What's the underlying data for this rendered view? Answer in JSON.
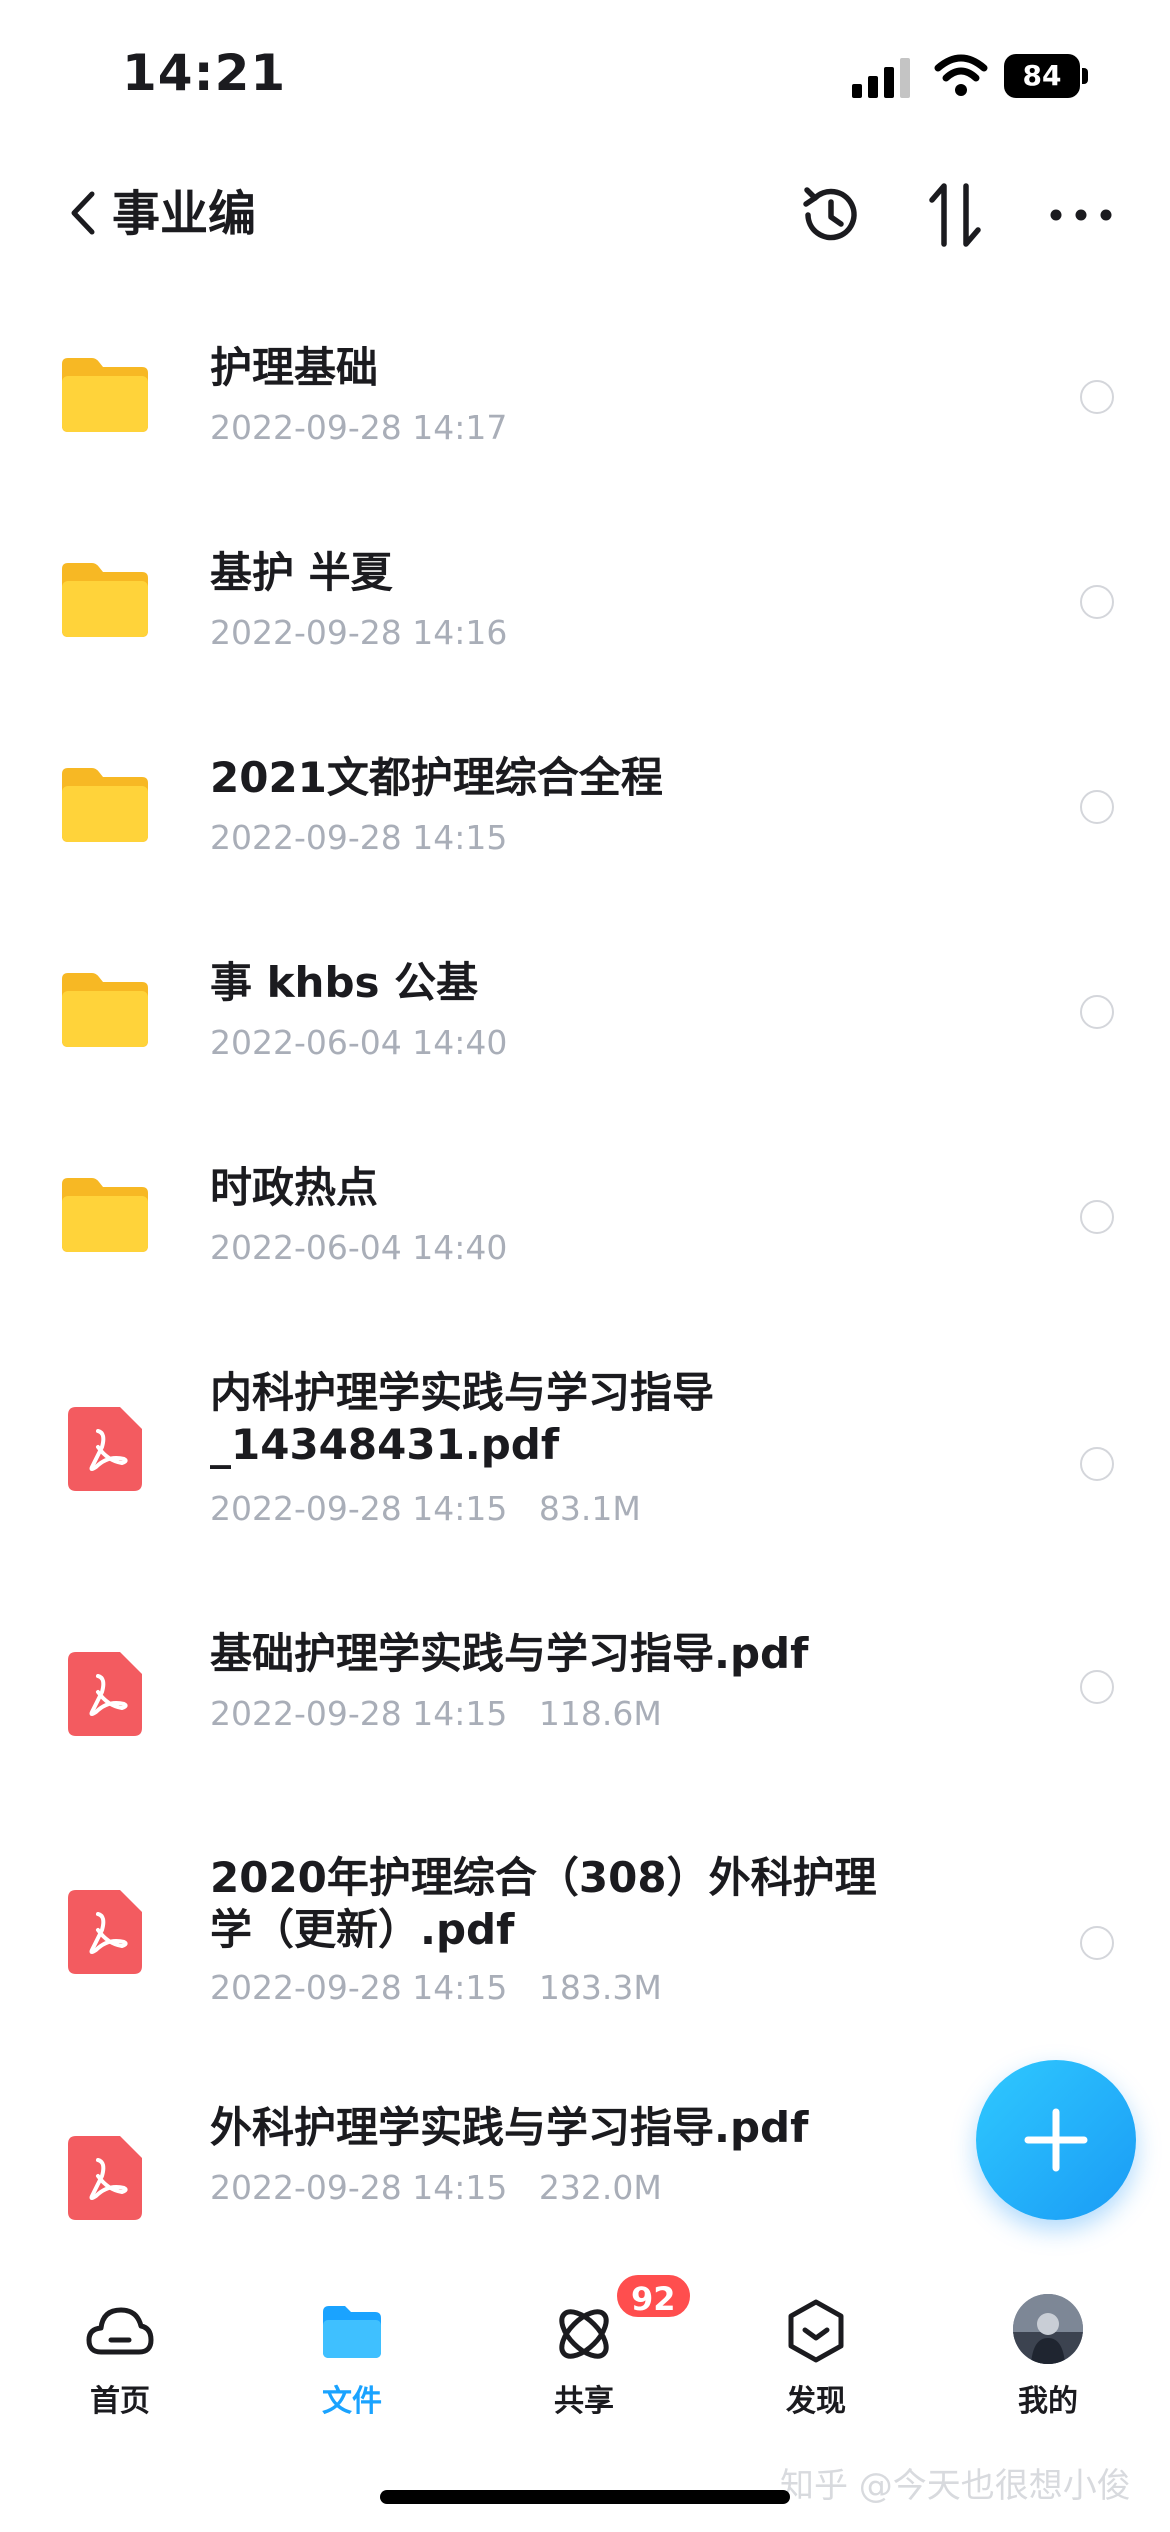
{
  "status": {
    "time": "14:21",
    "battery": "84"
  },
  "header": {
    "title": "事业编"
  },
  "files": [
    {
      "type": "folder",
      "name": "护理基础",
      "date": "2022-09-28 14:17",
      "size": ""
    },
    {
      "type": "folder",
      "name": "基护 半夏",
      "date": "2022-09-28 14:16",
      "size": ""
    },
    {
      "type": "folder",
      "name": "2021文都护理综合全程",
      "date": "2022-09-28 14:15",
      "size": ""
    },
    {
      "type": "folder",
      "name": "事 khbs 公基",
      "date": "2022-06-04 14:40",
      "size": ""
    },
    {
      "type": "folder",
      "name": "时政热点",
      "date": "2022-06-04 14:40",
      "size": ""
    },
    {
      "type": "pdf",
      "name": "内科护理学实践与学习指导_14348431.pdf",
      "date": "2022-09-28 14:15",
      "size": "83.1M"
    },
    {
      "type": "pdf",
      "name": "基础护理学实践与学习指导.pdf",
      "date": "2022-09-28 14:15",
      "size": "118.6M"
    },
    {
      "type": "pdf",
      "name": "2020年护理综合（308）外科护理学（更新）.pdf",
      "date": "2022-09-28 14:15",
      "size": "183.3M"
    },
    {
      "type": "pdf",
      "name": "外科护理学实践与学习指导.pdf",
      "date": "2022-09-28 14:15",
      "size": "232.0M"
    }
  ],
  "tabs": [
    {
      "label": "首页",
      "icon": "cloud-icon",
      "active": false
    },
    {
      "label": "文件",
      "icon": "folder-icon",
      "active": true
    },
    {
      "label": "共享",
      "icon": "share-orbit-icon",
      "active": false,
      "badge": "92"
    },
    {
      "label": "发现",
      "icon": "discover-cube-icon",
      "active": false
    },
    {
      "label": "我的",
      "icon": "avatar",
      "active": false
    }
  ],
  "watermark": "知乎 @今天也很想小俊",
  "colors": {
    "accent": "#1aa3ff",
    "folder": "#ffcc33",
    "pdf": "#f35b60",
    "badge": "#ff4e4e",
    "meta": "#a9aeb8"
  }
}
